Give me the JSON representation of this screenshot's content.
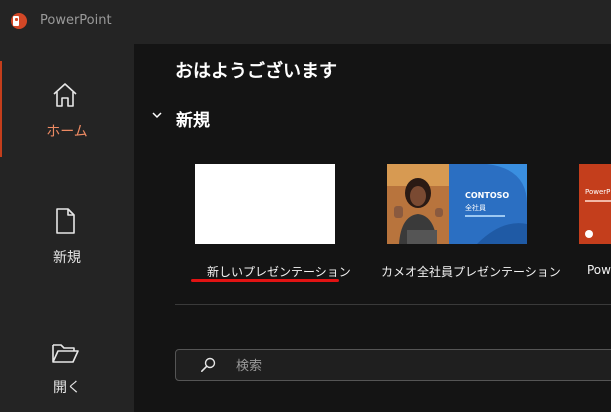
{
  "app": {
    "title": "PowerPoint"
  },
  "colors": {
    "accent": "#c43e1c",
    "accent_text": "#ed8a63",
    "underline": "#e21313"
  },
  "sidebar": {
    "items": [
      {
        "label": "ホーム",
        "icon": "home-icon",
        "active": true
      },
      {
        "label": "新規",
        "icon": "new-document-icon",
        "active": false
      },
      {
        "label": "開く",
        "icon": "open-folder-icon",
        "active": false
      }
    ]
  },
  "main": {
    "greeting": "おはようございます",
    "new_section": {
      "title": "新規",
      "templates": [
        {
          "label": "新しいプレゼンテーション",
          "highlighted": true
        },
        {
          "label": "カメオ全社員プレゼンテーション",
          "thumb_title": "CONTOSO",
          "thumb_subtitle": "全社員"
        },
        {
          "label": "Pow",
          "thumb_title": "PowerP"
        }
      ]
    },
    "search": {
      "placeholder": "検索"
    }
  }
}
